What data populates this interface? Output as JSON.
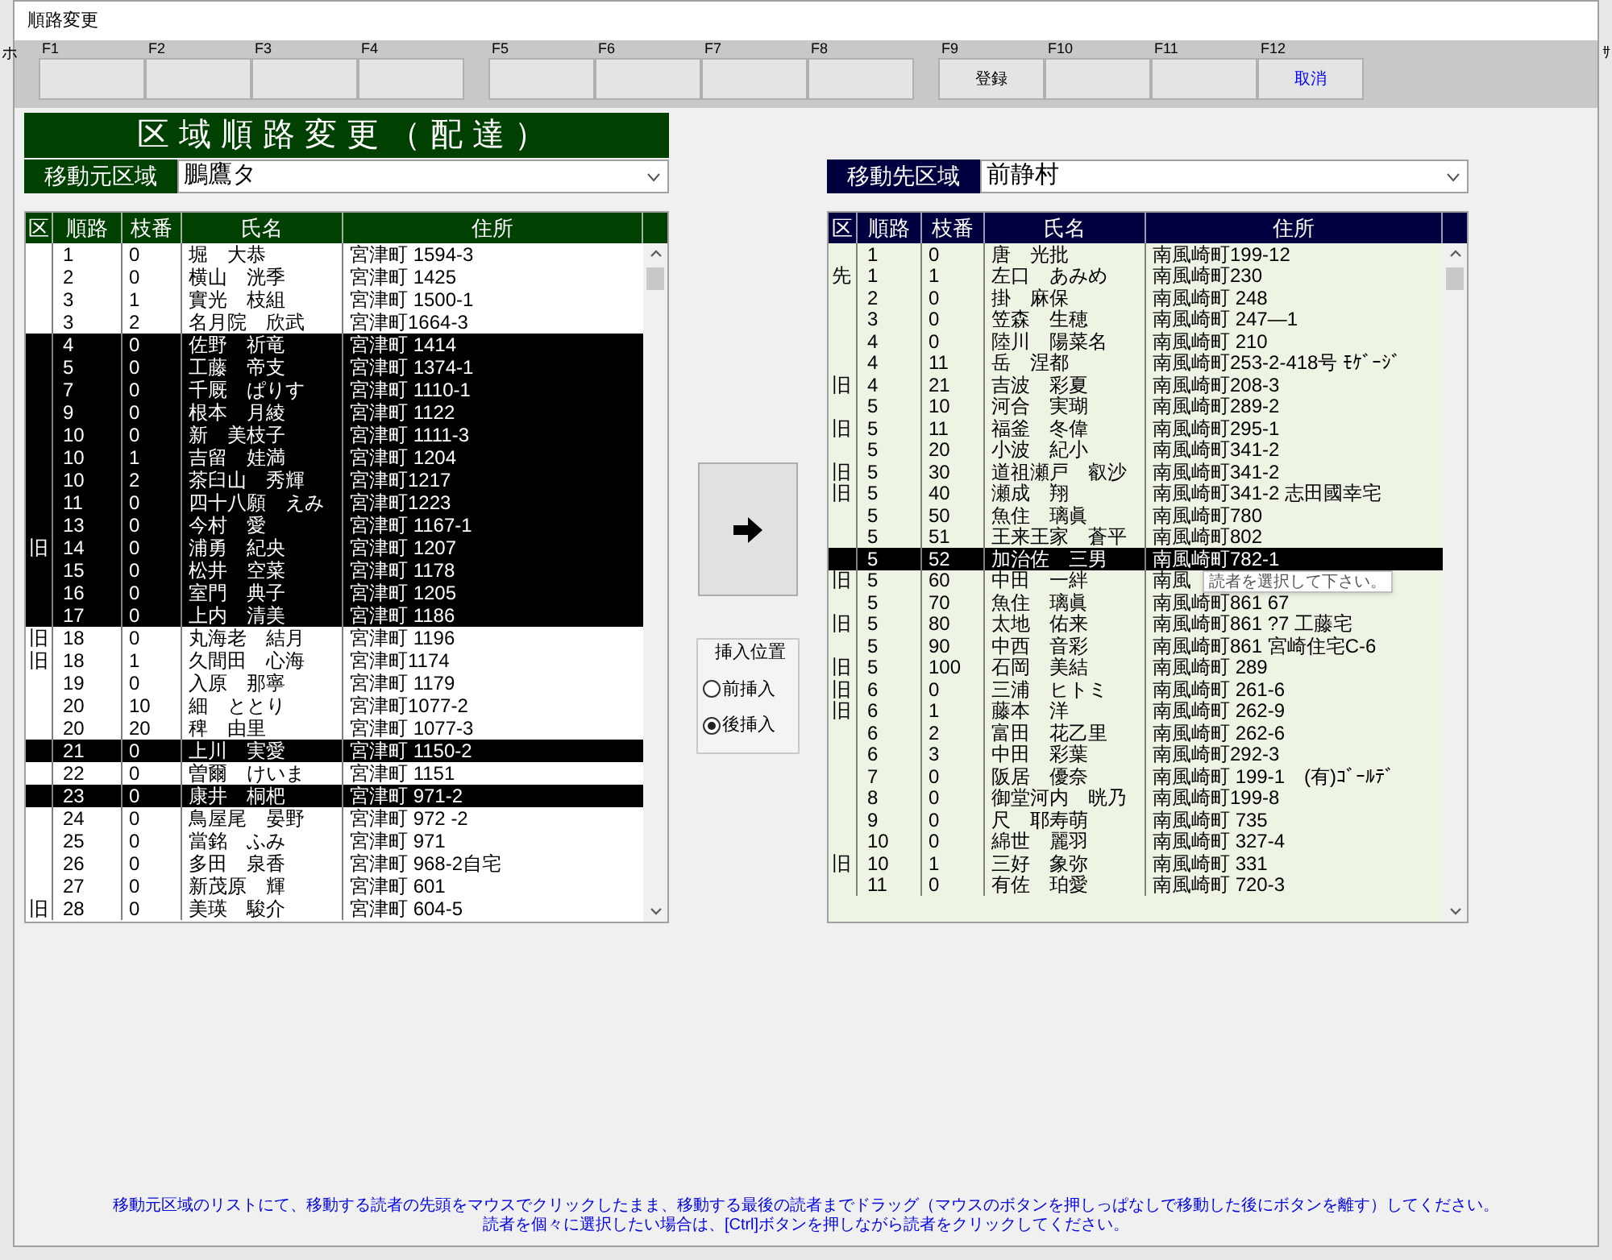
{
  "window": {
    "title": "順路変更"
  },
  "background_edge": {
    "left": "ホ",
    "right": "ｻ"
  },
  "function_keys": [
    {
      "key": "F1"
    },
    {
      "key": "F2"
    },
    {
      "key": "F3"
    },
    {
      "key": "F4"
    },
    {
      "key": "F5"
    },
    {
      "key": "F6"
    },
    {
      "key": "F7"
    },
    {
      "key": "F8"
    },
    {
      "key": "F9",
      "label": "登録",
      "kind": "action"
    },
    {
      "key": "F10"
    },
    {
      "key": "F11"
    },
    {
      "key": "F12",
      "label": "取消",
      "kind": "cancel"
    }
  ],
  "heading": "区域順路変更（配達）",
  "source": {
    "label": "移動元区域",
    "value": "鵬鷹タ"
  },
  "destination": {
    "label": "移動先区域",
    "value": "前静村"
  },
  "source_columns": [
    "区",
    "順路",
    "枝番",
    "氏名",
    "住所"
  ],
  "destination_columns": [
    "区",
    "順路",
    "枝番",
    "氏名",
    "住所"
  ],
  "source_list": [
    {
      "route": "1",
      "branch": "0",
      "name": "堀　大恭",
      "address": "宮津町 1594-3",
      "selected": false
    },
    {
      "route": "2",
      "branch": "0",
      "name": "横山　洸季",
      "address": "宮津町 1425",
      "selected": false
    },
    {
      "route": "3",
      "branch": "1",
      "name": "實光　枝組",
      "address": "宮津町 1500-1",
      "selected": false
    },
    {
      "route": "3",
      "branch": "2",
      "name": "名月院　欣武",
      "address": "宮津町1664-3",
      "selected": false
    },
    {
      "route": "4",
      "branch": "0",
      "name": "佐野　祈竜",
      "address": "宮津町 1414",
      "selected": true
    },
    {
      "route": "5",
      "branch": "0",
      "name": "工藤　帝支",
      "address": "宮津町 1374-1",
      "selected": true
    },
    {
      "route": "7",
      "branch": "0",
      "name": "千厩　ぱりす",
      "address": "宮津町 1110-1",
      "selected": true
    },
    {
      "route": "9",
      "branch": "0",
      "name": "根本　月綾",
      "address": "宮津町 1122",
      "selected": true
    },
    {
      "route": "10",
      "branch": "0",
      "name": "新　美枝子",
      "address": "宮津町 1111-3",
      "selected": true
    },
    {
      "route": "10",
      "branch": "1",
      "name": "吉留　娃満",
      "address": "宮津町 1204",
      "selected": true
    },
    {
      "route": "10",
      "branch": "2",
      "name": "茶臼山　秀輝",
      "address": "宮津町1217",
      "selected": true
    },
    {
      "route": "11",
      "branch": "0",
      "name": "四十八願　えみ",
      "address": "宮津町1223",
      "selected": true
    },
    {
      "route": "13",
      "branch": "0",
      "name": "今村　愛",
      "address": "宮津町 1167-1",
      "selected": true
    },
    {
      "area": "旧",
      "route": "14",
      "branch": "0",
      "name": "浦勇　紀央",
      "address": "宮津町 1207",
      "selected": true
    },
    {
      "route": "15",
      "branch": "0",
      "name": "松井　空菜",
      "address": "宮津町 1178",
      "selected": true
    },
    {
      "route": "16",
      "branch": "0",
      "name": "室門　典子",
      "address": "宮津町 1205",
      "selected": true
    },
    {
      "route": "17",
      "branch": "0",
      "name": "上内　清美",
      "address": "宮津町 1186",
      "selected": true
    },
    {
      "area": "旧",
      "route": "18",
      "branch": "0",
      "name": "丸海老　結月",
      "address": "宮津町 1196",
      "selected": false
    },
    {
      "area": "旧",
      "route": "18",
      "branch": "1",
      "name": "久間田　心海",
      "address": "宮津町1174",
      "selected": false
    },
    {
      "route": "19",
      "branch": "0",
      "name": "入原　那寧",
      "address": "宮津町 1179",
      "selected": false
    },
    {
      "route": "20",
      "branch": "10",
      "name": "細　ととり",
      "address": "宮津町1077-2",
      "selected": false
    },
    {
      "route": "20",
      "branch": "20",
      "name": "稗　由里",
      "address": "宮津町 1077-3",
      "selected": false
    },
    {
      "route": "21",
      "branch": "0",
      "name": "上川　実愛",
      "address": "宮津町 1150-2",
      "selected": true
    },
    {
      "route": "22",
      "branch": "0",
      "name": "曽爾　けいま",
      "address": "宮津町 1151",
      "selected": false
    },
    {
      "route": "23",
      "branch": "0",
      "name": "康井　桐杷",
      "address": "宮津町 971-2",
      "selected": true
    },
    {
      "route": "24",
      "branch": "0",
      "name": "鳥屋尾　晏野",
      "address": "宮津町 972 -2",
      "selected": false
    },
    {
      "route": "25",
      "branch": "0",
      "name": "當銘　ふみ",
      "address": "宮津町 971",
      "selected": false
    },
    {
      "route": "26",
      "branch": "0",
      "name": "多田　泉香",
      "address": "宮津町 968-2自宅",
      "selected": false
    },
    {
      "route": "27",
      "branch": "0",
      "name": "新茂原　輝",
      "address": "宮津町 601",
      "selected": false
    },
    {
      "area": "旧",
      "route": "28",
      "branch": "0",
      "name": "美瑛　駿介",
      "address": "宮津町 604-5",
      "selected": false
    }
  ],
  "insert_position": {
    "label": "挿入位置",
    "options": [
      {
        "label": "前挿入",
        "selected": false
      },
      {
        "label": "後挿入",
        "selected": true
      }
    ]
  },
  "destination_list": [
    {
      "route": "1",
      "branch": "0",
      "name": "唐　光批",
      "address": "南風崎町199-12",
      "selected": false
    },
    {
      "area": "先",
      "route": "1",
      "branch": "1",
      "name": "左口　あみめ",
      "address": "南風崎町230",
      "selected": false
    },
    {
      "route": "2",
      "branch": "0",
      "name": "掛　麻保",
      "address": "南風崎町 248",
      "selected": false
    },
    {
      "route": "3",
      "branch": "0",
      "name": "笠森　生穂",
      "address": "南風崎町 247―1",
      "selected": false
    },
    {
      "route": "4",
      "branch": "0",
      "name": "陸川　陽菜名",
      "address": "南風崎町 210",
      "selected": false
    },
    {
      "route": "4",
      "branch": "11",
      "name": "岳　涅都",
      "address": "南風崎町253-2-418号 ﾓｹﾞｰｼﾞ",
      "selected": false
    },
    {
      "area": "旧",
      "route": "4",
      "branch": "21",
      "name": "吉波　彩夏",
      "address": "南風崎町208-3",
      "selected": false
    },
    {
      "route": "5",
      "branch": "10",
      "name": "河合　実瑚",
      "address": "南風崎町289-2",
      "selected": false
    },
    {
      "area": "旧",
      "route": "5",
      "branch": "11",
      "name": "福釜　冬偉",
      "address": "南風崎町295-1",
      "selected": false
    },
    {
      "route": "5",
      "branch": "20",
      "name": "小波　紀小",
      "address": "南風崎町341-2",
      "selected": false
    },
    {
      "area": "旧",
      "route": "5",
      "branch": "30",
      "name": "道祖瀬戸　叡沙",
      "address": "南風崎町341-2",
      "selected": false
    },
    {
      "area": "旧",
      "route": "5",
      "branch": "40",
      "name": "瀬成　翔",
      "address": "南風崎町341-2 志田國幸宅",
      "selected": false
    },
    {
      "route": "5",
      "branch": "50",
      "name": "魚住　璃眞",
      "address": "南風崎町780",
      "selected": false
    },
    {
      "route": "5",
      "branch": "51",
      "name": "王来王家　蒼平",
      "address": "南風崎町802",
      "selected": false
    },
    {
      "route": "5",
      "branch": "52",
      "name": "加治佐　三男",
      "address": "南風崎町782-1",
      "selected": true
    },
    {
      "area": "旧",
      "route": "5",
      "branch": "60",
      "name": "中田　一絆",
      "address": "南風",
      "selected": false
    },
    {
      "route": "5",
      "branch": "70",
      "name": "魚住　璃眞",
      "address": "南風崎町861 67",
      "selected": false
    },
    {
      "area": "旧",
      "route": "5",
      "branch": "80",
      "name": "太地　佑来",
      "address": "南風崎町861 ?7 工藤宅",
      "selected": false
    },
    {
      "route": "5",
      "branch": "90",
      "name": "中西　音彩",
      "address": "南風崎町861 宮崎住宅C-6",
      "selected": false
    },
    {
      "area": "旧",
      "route": "5",
      "branch": "100",
      "name": "石岡　美結",
      "address": "南風崎町 289",
      "selected": false
    },
    {
      "area": "旧",
      "route": "6",
      "branch": "0",
      "name": "三浦　ヒトミ",
      "address": "南風崎町 261-6",
      "selected": false
    },
    {
      "area": "旧",
      "route": "6",
      "branch": "1",
      "name": "藤本　洋",
      "address": "南風崎町 262-9",
      "selected": false
    },
    {
      "route": "6",
      "branch": "2",
      "name": "富田　花乙里",
      "address": "南風崎町 262-6",
      "selected": false
    },
    {
      "route": "6",
      "branch": "3",
      "name": "中田　彩葉",
      "address": "南風崎町292-3",
      "selected": false
    },
    {
      "route": "7",
      "branch": "0",
      "name": "阪居　優奈",
      "address": "南風崎町 199-1　(有)ｺﾞｰﾙﾃﾞ",
      "selected": false
    },
    {
      "route": "8",
      "branch": "0",
      "name": "御堂河内　晄乃",
      "address": "南風崎町199-8",
      "selected": false
    },
    {
      "route": "9",
      "branch": "0",
      "name": "尺　耶寿萌",
      "address": "南風崎町 735",
      "selected": false
    },
    {
      "route": "10",
      "branch": "0",
      "name": "綿世　麗羽",
      "address": "南風崎町 327-4",
      "selected": false
    },
    {
      "area": "旧",
      "route": "10",
      "branch": "1",
      "name": "三好　象弥",
      "address": "南風崎町 331",
      "selected": false
    },
    {
      "route": "11",
      "branch": "0",
      "name": "有佐　珀愛",
      "address": "南風崎町 720-3",
      "selected": false
    }
  ],
  "tooltip": "読者を選択して下さい。",
  "footer": [
    "移動元区域のリストにて、移動する読者の先頭をマウスでクリックしたまま、移動する最後の読者までドラッグ（マウスのボタンを押しっぱなしで移動した後にボタンを離す）してください。",
    "読者を個々に選択したい場合は、[Ctrl]ボタンを押しながら読者をクリックしてください。"
  ]
}
